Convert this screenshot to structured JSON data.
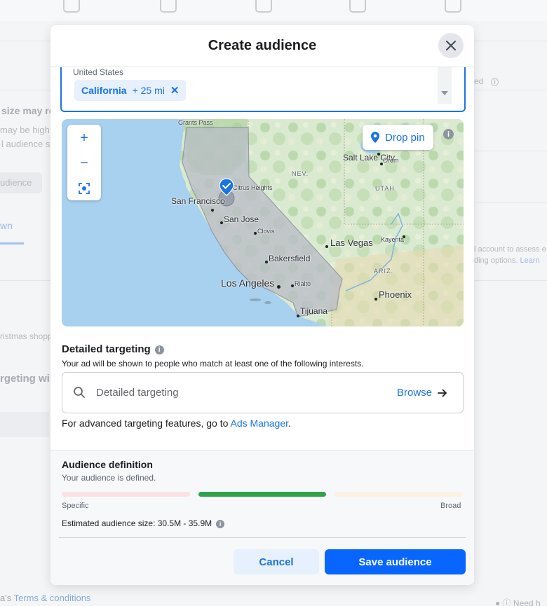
{
  "background": {
    "left_texts": [
      "size may re",
      "may be high",
      "l audience s",
      "udience",
      "wn",
      "ristmas shopp",
      "rgeting will"
    ],
    "right_texts": [
      "ed",
      "l account to assess e",
      "ding options.",
      "Learn"
    ],
    "footer_prefix": "a's",
    "footer_link": "Terms & conditions",
    "help_text": "Need h"
  },
  "modal": {
    "title": "Create audience"
  },
  "location": {
    "country": "United States",
    "chip_name": "California",
    "chip_radius": "+ 25 mi",
    "chip_remove": "✕"
  },
  "map": {
    "zoom_in": "+",
    "zoom_out": "−",
    "drop_pin_label": "Drop pin",
    "info": "i",
    "labels": {
      "grants_pass": "Grants Pass",
      "nev": "NEV.",
      "utah": "UTAH",
      "ariz": "ARIZ.",
      "salt_lake_city": "Salt Lake City",
      "orem": "Orem",
      "citrus_heights": "Citrus Heights",
      "san_francisco": "San Francisco",
      "san_jose": "San Jose",
      "clovis": "Clovis",
      "las_vegas": "Las Vegas",
      "kayenta": "Kayenta",
      "bakersfield": "Bakersfield",
      "los_angeles": "Los Angeles",
      "rialto": "Rialto",
      "phoenix": "Phoenix",
      "tijuana": "Tijuana"
    }
  },
  "detailed_targeting": {
    "title": "Detailed targeting",
    "subtitle": "Your ad will be shown to people who match at least one of the following interests.",
    "search_placeholder": "Detailed targeting",
    "browse_label": "Browse",
    "advanced_prefix": "For advanced targeting features, go to ",
    "ads_manager_link": "Ads Manager",
    "advanced_suffix": "."
  },
  "audience_definition": {
    "title": "Audience definition",
    "status": "Your audience is defined.",
    "specific_label": "Specific",
    "broad_label": "Broad",
    "meter_active_segment": 2,
    "colors": {
      "specific": "#fbe1e3",
      "defined": "#31a24c",
      "broad": "#fdf1e1"
    },
    "estimated_size": "Estimated audience size: 30.5M - 35.9M"
  },
  "buttons": {
    "cancel": "Cancel",
    "save": "Save audience"
  },
  "colors": {
    "accent": "#1b74e4",
    "primary_button": "#0866ff"
  }
}
